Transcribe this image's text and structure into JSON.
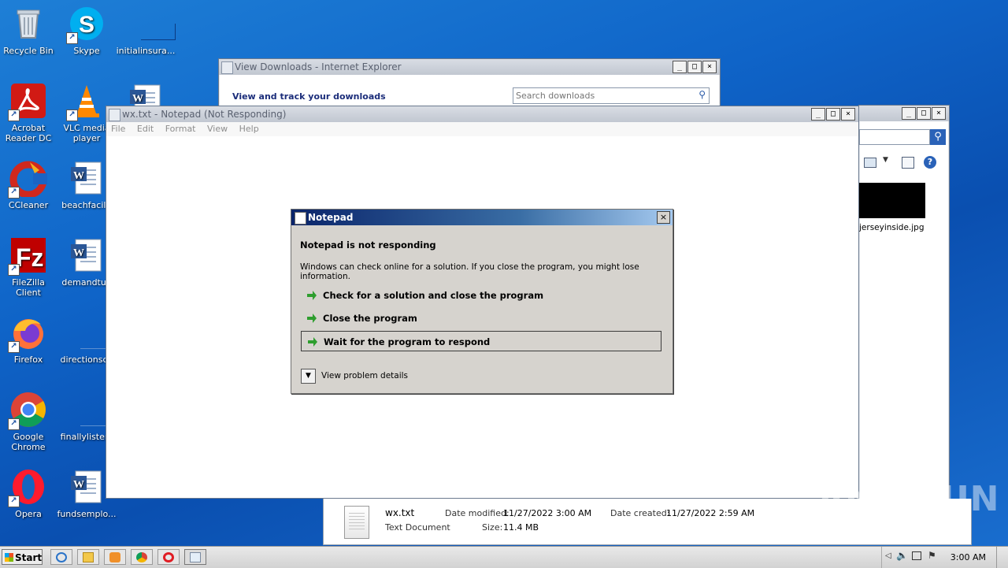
{
  "desktop": {
    "icons": [
      {
        "label": "Recycle Bin",
        "icon": "recycle-bin-icon"
      },
      {
        "label": "Skype",
        "icon": "skype-icon"
      },
      {
        "label": "initialinsura...",
        "icon": "blank-file-icon"
      },
      {
        "label": "Acrobat Reader DC",
        "icon": "acrobat-icon"
      },
      {
        "label": "VLC media player",
        "icon": "vlc-icon"
      },
      {
        "label": "CCleaner",
        "icon": "ccleaner-icon"
      },
      {
        "label": "beachfacilit",
        "icon": "word-doc-icon"
      },
      {
        "label": "FileZilla Client",
        "icon": "filezilla-icon"
      },
      {
        "label": "demandtue",
        "icon": "word-doc-icon"
      },
      {
        "label": "Firefox",
        "icon": "firefox-icon"
      },
      {
        "label": "directionsch",
        "icon": "blank-file-icon"
      },
      {
        "label": "Google Chrome",
        "icon": "chrome-icon"
      },
      {
        "label": "finallylisten.",
        "icon": "blank-file-icon"
      },
      {
        "label": "Opera",
        "icon": "opera-icon"
      },
      {
        "label": "fundsemplo...",
        "icon": "word-doc-icon"
      }
    ]
  },
  "ie_window": {
    "title": "View Downloads - Internet Explorer",
    "heading": "View and track your downloads",
    "search_placeholder": "Search downloads"
  },
  "explorer_window": {
    "file_thumb_label": "jerseyinside.jpg",
    "details": {
      "name": "wx.txt",
      "type": "Text Document",
      "modified_label": "Date modified:",
      "modified_value": "11/27/2022 3:00 AM",
      "created_label": "Date created:",
      "created_value": "11/27/2022 2:59 AM",
      "size_label": "Size:",
      "size_value": "11.4 MB"
    }
  },
  "notepad_window": {
    "title": "wx.txt - Notepad (Not Responding)",
    "menu": [
      "File",
      "Edit",
      "Format",
      "View",
      "Help"
    ]
  },
  "dialog": {
    "title": "Notepad",
    "heading": "Notepad is not responding",
    "message": "Windows can check online for a solution. If you close the program, you might lose information.",
    "options": [
      "Check for a solution and close the program",
      "Close the program",
      "Wait for the program to respond"
    ],
    "details_label": "View problem details"
  },
  "taskbar": {
    "start_label": "Start",
    "clock": "3:00 AM"
  },
  "watermark": "ANY RUN"
}
